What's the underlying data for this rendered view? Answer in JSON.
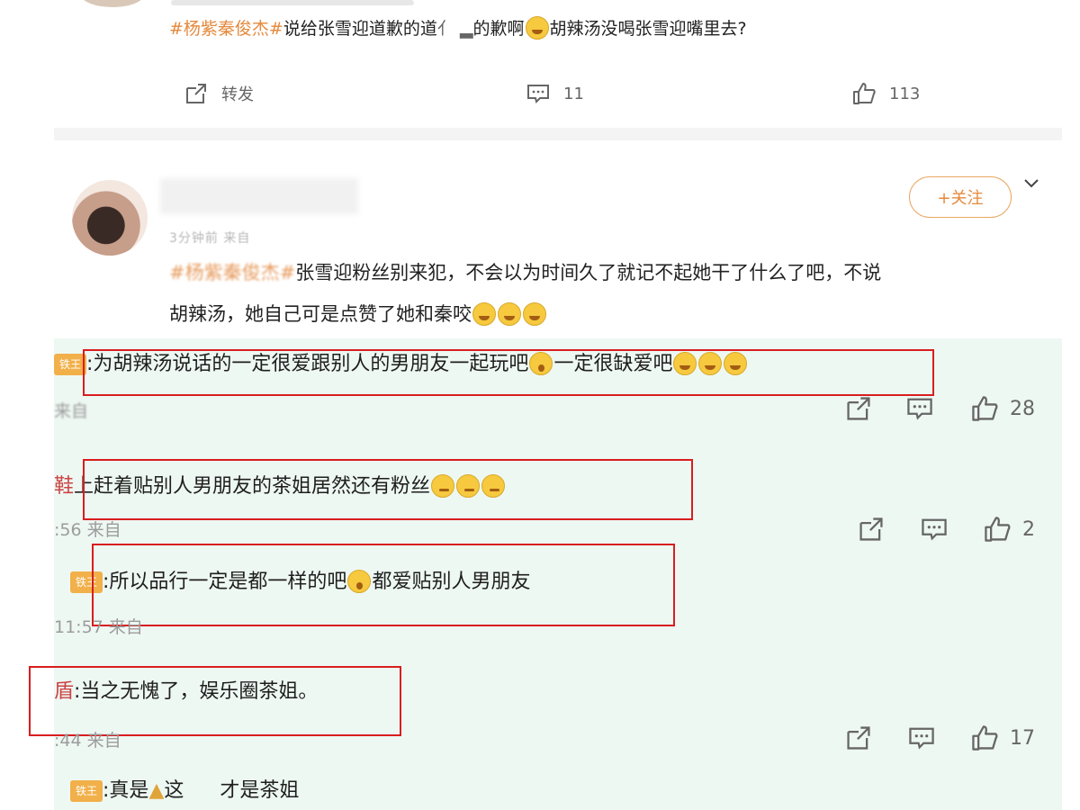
{
  "post": {
    "hashtag": "#杨紫秦俊杰#",
    "text_before_emoji": "说给张雪迎道歉的道",
    "text_after_emoji": "胡辣汤没喝张雪迎嘴里去?",
    "text_mid": "的歉啊",
    "repost_label": "转发",
    "comment_count": "11",
    "like_count": "113"
  },
  "comment": {
    "time": "3分钟前 来自",
    "follow_label": "+关注",
    "line1_text": "张雪迎粉丝别来犯",
    "line1_rest": "，不会以为时间久了就记不起她干了什么了吧，不说",
    "line2_text": "胡辣汤，她自己可是点赞了她和秦咬"
  },
  "replies": [
    {
      "badge": "铁王",
      "text_a": ":为胡辣汤说话的一定很爱跟别人的男朋友一起玩吧",
      "text_b": "一定很缺爱吧",
      "meta": "来自",
      "likes": "28"
    },
    {
      "prefix": "鞋",
      "text_a": "上赶着贴别人男朋友的茶姐居然还有粉丝",
      "meta": ":56 来自",
      "likes": "2"
    },
    {
      "badge": "铁王",
      "text_a": ":所以品行一定是都一样的吧",
      "text_b": "都爱贴别人男朋友",
      "meta": "11:57 来自"
    },
    {
      "prefix": "盾",
      "text_a": ":当之无愧了，娱乐圈茶姐。",
      "meta": ":44 来自",
      "likes": "17"
    },
    {
      "badge": "铁王",
      "text_a": ":真是",
      "text_b": "这",
      "text_c": "才是茶姐"
    }
  ],
  "colors": {
    "hashtag": "#e5893c",
    "highlight_border": "#d81e1e",
    "reply_background": "#eef8f3",
    "follow_border": "#e8a761"
  },
  "icons": [
    "repost-icon",
    "comment-icon",
    "like-icon",
    "chevron-down-icon",
    "emoji-icon",
    "pray-icon"
  ]
}
